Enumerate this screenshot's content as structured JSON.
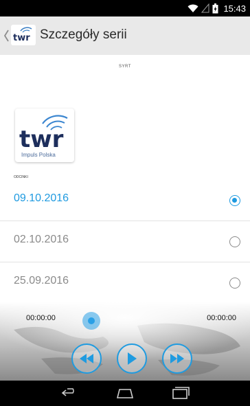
{
  "status_bar": {
    "time": "15:43",
    "icons": [
      "wifi-icon",
      "signal-icon",
      "battery-icon"
    ]
  },
  "action_bar": {
    "title": "Szczegóły serii",
    "logo_text": "twr",
    "icons": [
      "up-caret-icon",
      "app-logo"
    ]
  },
  "series": {
    "code": "SYRT",
    "episodes_label": "ODCINKI",
    "logo_text": "twr",
    "logo_caption": "Impuls Polska"
  },
  "episodes": [
    {
      "date": "09.10.2016",
      "selected": true
    },
    {
      "date": "02.10.2016",
      "selected": false
    },
    {
      "date": "25.09.2016",
      "selected": false
    }
  ],
  "player": {
    "position": "00:00:00",
    "duration": "00:00:00",
    "progress": 0,
    "controls": [
      "rewind-icon",
      "play-icon",
      "fast-forward-icon"
    ]
  },
  "nav_bar": {
    "icons": [
      "back-icon",
      "home-icon",
      "recents-icon"
    ]
  },
  "colors": {
    "accent": "#1e9ae0",
    "action_bar_bg": "#e9e9e9",
    "system_bar_bg": "#000000"
  }
}
